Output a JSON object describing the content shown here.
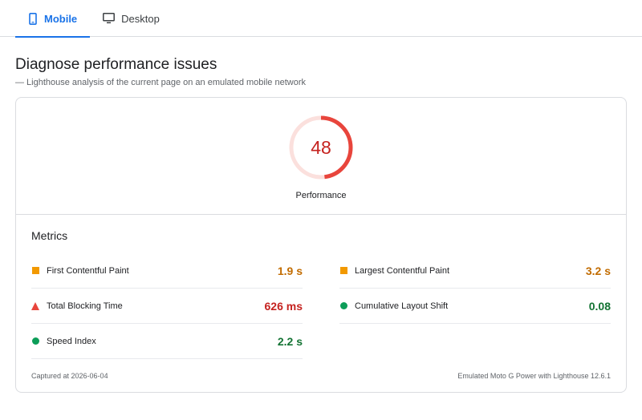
{
  "tabs": [
    {
      "label": "Mobile",
      "icon": "smartphone-icon",
      "active": true
    },
    {
      "label": "Desktop",
      "icon": "monitor-icon",
      "active": false
    }
  ],
  "page": {
    "title": "Diagnose performance issues",
    "subtitle": "— Lighthouse analysis of the current page on an emulated mobile network"
  },
  "gauge": {
    "score": "48",
    "label": "Performance",
    "fraction": 0.48,
    "color": "#e8453c",
    "track_color": "#fbe0dd"
  },
  "metrics": {
    "heading": "Metrics",
    "items": [
      {
        "name": "First Contentful Paint",
        "value": "1.9 s",
        "marker": "square",
        "color": "#f29900"
      },
      {
        "name": "Largest Contentful Paint",
        "value": "3.2 s",
        "marker": "square",
        "color": "#f29900"
      },
      {
        "name": "Total Blocking Time",
        "value": "626 ms",
        "marker": "triangle",
        "color": "#e8453c"
      },
      {
        "name": "Cumulative Layout Shift",
        "value": "0.08",
        "marker": "circle",
        "color": "#0c9d58"
      },
      {
        "name": "Speed Index",
        "value": "2.2 s",
        "marker": "circle",
        "color": "#0c9d58"
      }
    ],
    "value_colors": {
      "orange": "#c26c00",
      "red": "#c5221f",
      "green": "#137333"
    }
  },
  "footer": {
    "captured": "Captured at 2026-06-04",
    "device": "Emulated Moto G Power with Lighthouse 12.6.1"
  }
}
